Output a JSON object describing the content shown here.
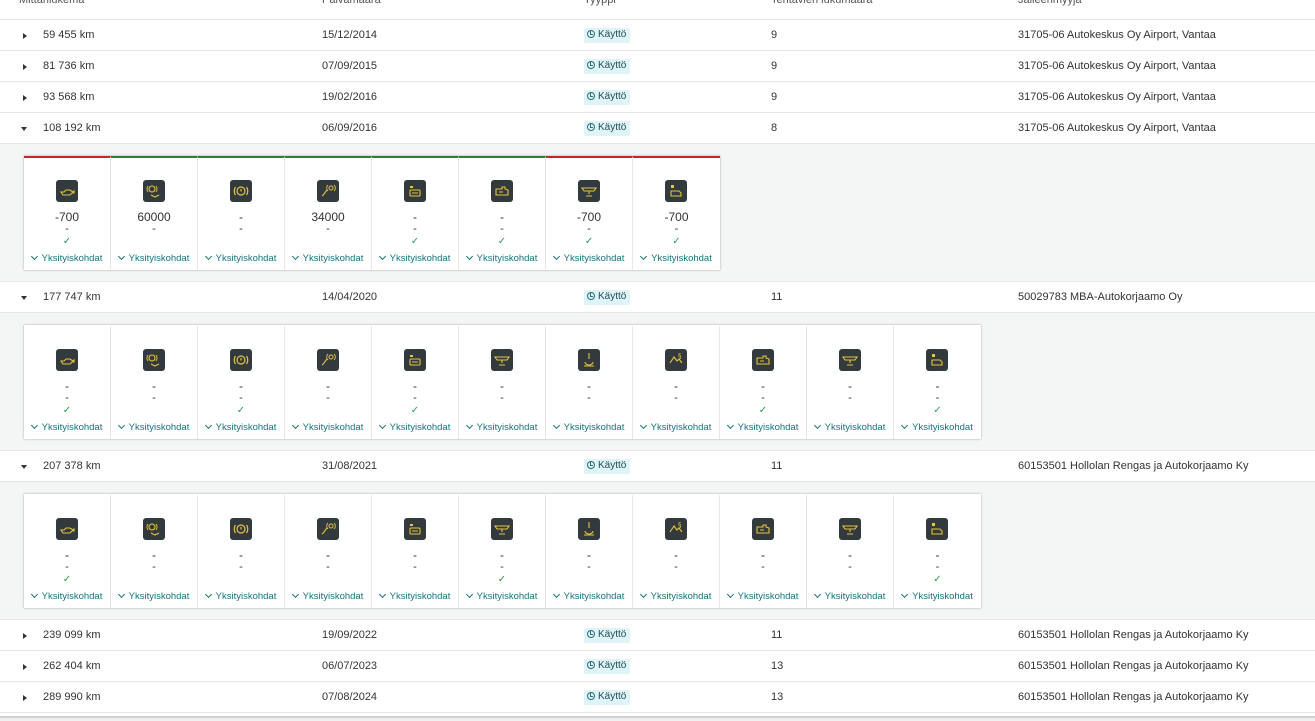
{
  "header": {
    "columns": [
      "Mittarilukema",
      "Päivämäärä",
      "Tyyppi",
      "Tehtävien lukumäärä",
      "Jälleenmyyjä"
    ]
  },
  "type_label": "Käyttö",
  "details_label": "Yksityiskohdat",
  "colors": {
    "red": "#c62828",
    "green": "#2e7d32",
    "accent": "#14737d",
    "badge_bg": "#dff4f6"
  },
  "rows": [
    {
      "km": "59 455 km",
      "date": "15/12/2014",
      "count": "9",
      "dealer": "31705-06 Autokeskus Oy Airport, Vantaa",
      "expanded": false
    },
    {
      "km": "81 736 km",
      "date": "07/09/2015",
      "count": "9",
      "dealer": "31705-06 Autokeskus Oy Airport, Vantaa",
      "expanded": false
    },
    {
      "km": "93 568 km",
      "date": "19/02/2016",
      "count": "9",
      "dealer": "31705-06 Autokeskus Oy Airport, Vantaa",
      "expanded": false
    },
    {
      "km": "108 192 km",
      "date": "06/09/2016",
      "count": "8",
      "dealer": "31705-06 Autokeskus Oy Airport, Vantaa",
      "expanded": true
    },
    {
      "km": "177 747 km",
      "date": "14/04/2020",
      "count": "11",
      "dealer": "50029783 MBA-Autokorjaamo Oy",
      "expanded": true
    },
    {
      "km": "207 378 km",
      "date": "31/08/2021",
      "count": "11",
      "dealer": "60153501 Hollolan Rengas ja Autokorjaamo Ky",
      "expanded": true
    },
    {
      "km": "239 099 km",
      "date": "19/09/2022",
      "count": "11",
      "dealer": "60153501 Hollolan Rengas ja Autokorjaamo Ky",
      "expanded": false
    },
    {
      "km": "262 404 km",
      "date": "06/07/2023",
      "count": "13",
      "dealer": "60153501 Hollolan Rengas ja Autokorjaamo Ky",
      "expanded": false
    },
    {
      "km": "289 990 km",
      "date": "07/08/2024",
      "count": "13",
      "dealer": "60153501 Hollolan Rengas ja Autokorjaamo Ky",
      "expanded": false
    }
  ],
  "details": {
    "3": [
      {
        "icon": "oil-can-icon",
        "v1": "-700",
        "v2": "-",
        "check": true,
        "status": "red"
      },
      {
        "icon": "brake-wear-icon",
        "v1": "60000",
        "v2": "-",
        "check": false,
        "status": "green"
      },
      {
        "icon": "brake-warning-icon",
        "v1": "-",
        "v2": "-",
        "check": false,
        "status": "green"
      },
      {
        "icon": "brake-pads-icon",
        "v1": "34000",
        "v2": "-",
        "check": false,
        "status": "green"
      },
      {
        "icon": "oil-filter-icon",
        "v1": "-",
        "v2": "-",
        "check": true,
        "status": "green"
      },
      {
        "icon": "fuel-filter-icon",
        "v1": "-",
        "v2": "-",
        "check": true,
        "status": "green"
      },
      {
        "icon": "engine-oil-icon",
        "v1": "-700",
        "v2": "-",
        "check": true,
        "status": "red"
      },
      {
        "icon": "air-filter-icon",
        "v1": "-700",
        "v2": "-",
        "check": true,
        "status": "red"
      }
    ],
    "4": [
      {
        "icon": "oil-can-icon",
        "v1": "-",
        "v2": "-",
        "check": true,
        "status": "none"
      },
      {
        "icon": "brake-wear-icon",
        "v1": "-",
        "v2": "-",
        "check": false,
        "status": "none"
      },
      {
        "icon": "brake-warning-icon",
        "v1": "-",
        "v2": "-",
        "check": true,
        "status": "none"
      },
      {
        "icon": "brake-pads-icon",
        "v1": "-",
        "v2": "-",
        "check": false,
        "status": "none"
      },
      {
        "icon": "oil-filter-icon",
        "v1": "-",
        "v2": "-",
        "check": true,
        "status": "none"
      },
      {
        "icon": "engine-oil-icon",
        "v1": "-",
        "v2": "-",
        "check": false,
        "status": "none"
      },
      {
        "icon": "coolant-icon",
        "v1": "-",
        "v2": "-",
        "check": false,
        "status": "none"
      },
      {
        "icon": "inspection-icon",
        "v1": "-",
        "v2": "-",
        "check": false,
        "status": "none"
      },
      {
        "icon": "fuel-filter-icon",
        "v1": "-",
        "v2": "-",
        "check": true,
        "status": "none"
      },
      {
        "icon": "engine-oil-icon",
        "v1": "-",
        "v2": "-",
        "check": false,
        "status": "none"
      },
      {
        "icon": "air-filter-icon",
        "v1": "-",
        "v2": "-",
        "check": true,
        "status": "none"
      }
    ],
    "5": [
      {
        "icon": "oil-can-icon",
        "v1": "-",
        "v2": "-",
        "check": true,
        "status": "none"
      },
      {
        "icon": "brake-wear-icon",
        "v1": "-",
        "v2": "-",
        "check": false,
        "status": "none"
      },
      {
        "icon": "brake-warning-icon",
        "v1": "-",
        "v2": "-",
        "check": false,
        "status": "none"
      },
      {
        "icon": "brake-pads-icon",
        "v1": "-",
        "v2": "-",
        "check": false,
        "status": "none"
      },
      {
        "icon": "oil-filter-icon",
        "v1": "-",
        "v2": "-",
        "check": false,
        "status": "none"
      },
      {
        "icon": "engine-oil-icon",
        "v1": "-",
        "v2": "-",
        "check": true,
        "status": "none"
      },
      {
        "icon": "coolant-icon",
        "v1": "-",
        "v2": "-",
        "check": false,
        "status": "none"
      },
      {
        "icon": "inspection-icon",
        "v1": "-",
        "v2": "-",
        "check": false,
        "status": "none"
      },
      {
        "icon": "fuel-filter-icon",
        "v1": "-",
        "v2": "-",
        "check": false,
        "status": "none"
      },
      {
        "icon": "engine-oil-icon",
        "v1": "-",
        "v2": "-",
        "check": false,
        "status": "none"
      },
      {
        "icon": "air-filter-icon",
        "v1": "-",
        "v2": "-",
        "check": true,
        "status": "none"
      }
    ]
  }
}
